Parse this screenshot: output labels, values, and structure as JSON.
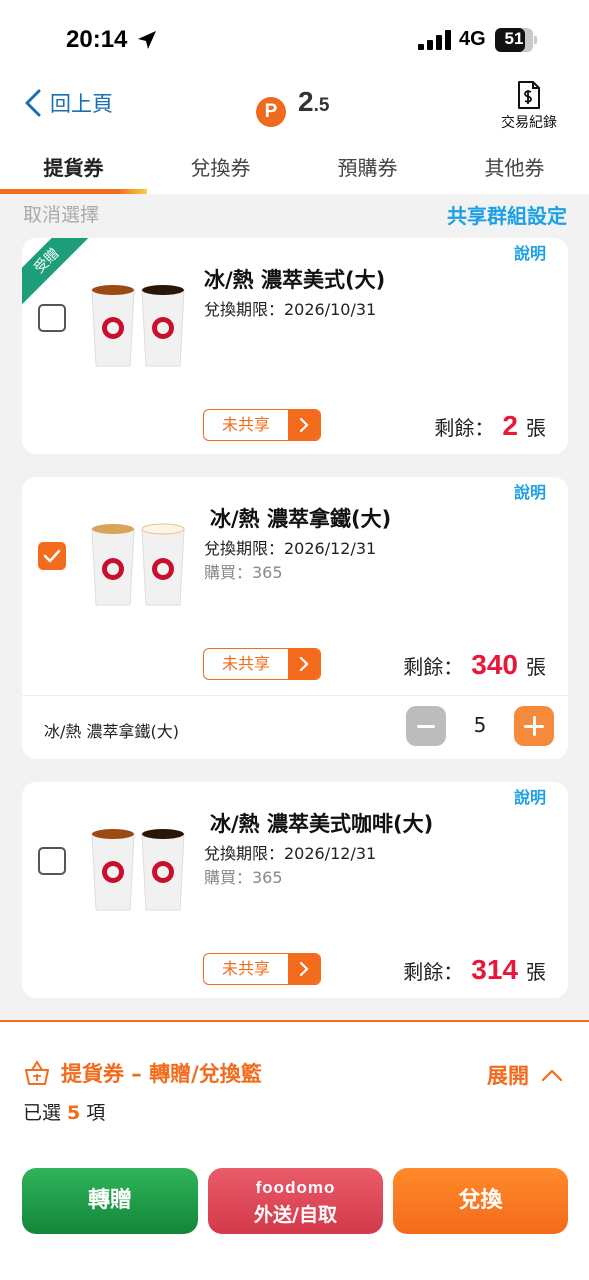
{
  "status_bar": {
    "time": "20:14",
    "network": "4G",
    "battery": "51"
  },
  "header": {
    "back_label": "回上頁",
    "points_int": "2",
    "points_dec": ".5",
    "points_badge": "P",
    "txn_label": "交易紀錄"
  },
  "tabs": [
    {
      "label": "提貨券",
      "active": true
    },
    {
      "label": "兌換券",
      "active": false
    },
    {
      "label": "預購券",
      "active": false
    },
    {
      "label": "其他券",
      "active": false
    }
  ],
  "toolbar": {
    "cancel_selection": "取消選擇",
    "group_settings": "共享群組設定"
  },
  "cards": [
    {
      "ribbon": "受贈",
      "explain": "說明",
      "name": "冰/熱 濃萃美式(大)",
      "expiry": "兌換期限：2026/10/31",
      "checked": false,
      "share_label": "未共享",
      "remain_label": "剩餘：",
      "remain_count": "2",
      "remain_unit": "張"
    },
    {
      "explain": "說明",
      "name": "冰/熱 濃萃拿鐵(大)",
      "expiry": "兌換期限：2026/12/31",
      "purchase": "購買：365",
      "checked": true,
      "share_label": "未共享",
      "remain_label": "剩餘：",
      "remain_count": "340",
      "remain_unit": "張",
      "qty_name": "冰/熱 濃萃拿鐵(大)",
      "qty_value": "5"
    },
    {
      "explain": "說明",
      "name": "冰/熱 濃萃美式咖啡(大)",
      "expiry": "兌換期限：2026/12/31",
      "purchase": "購買：365",
      "checked": false,
      "share_label": "未共享",
      "remain_label": "剩餘：",
      "remain_count": "314",
      "remain_unit": "張"
    }
  ],
  "basket": {
    "title": "提貨券 – 轉贈/兌換籃",
    "expand_label": "展開",
    "selected_prefix": "已選",
    "selected_count": "5",
    "selected_suffix": "項"
  },
  "actions": {
    "transfer": "轉贈",
    "foodomo_brand": "foodomo",
    "foodomo_label": "外送/自取",
    "exchange": "兌換"
  },
  "colors": {
    "accent": "#f36b1c",
    "link": "#1da1e6",
    "count_red": "#e8173a",
    "back_blue": "#1a6fb0",
    "green": "#1d9e7a"
  }
}
